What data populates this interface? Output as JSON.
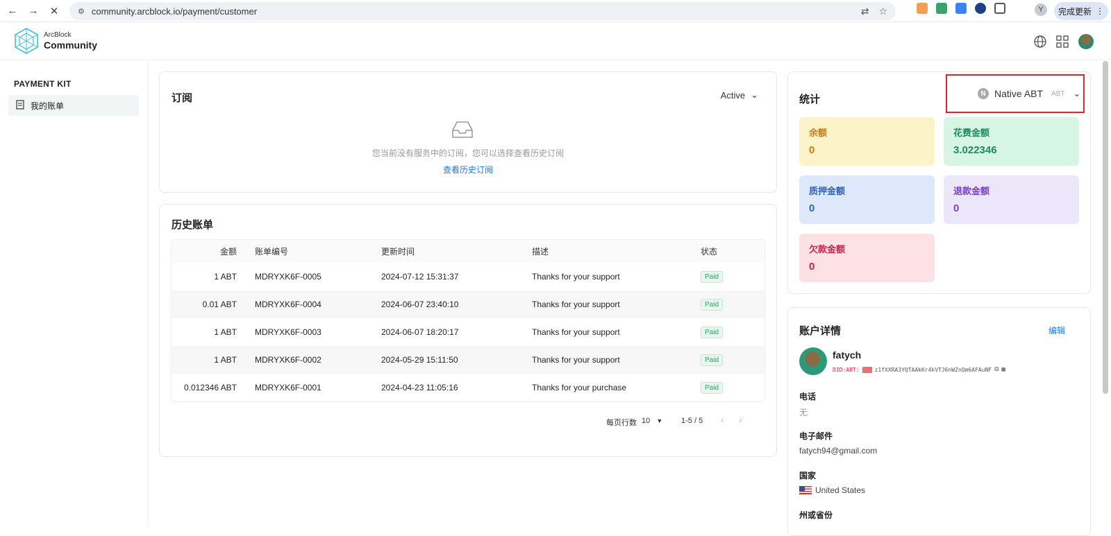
{
  "browser": {
    "url": "community.arcblock.io/payment/customer",
    "profile_initial": "Y",
    "update_label": "完成更新"
  },
  "header": {
    "brand_small": "ArcBlock",
    "brand_big": "Community"
  },
  "sidebar": {
    "section_title": "PAYMENT KIT",
    "items": [
      {
        "label": "我的账单",
        "icon": "receipt-icon"
      }
    ]
  },
  "subscriptions": {
    "title": "订阅",
    "filter_value": "Active",
    "empty_text": "您当前没有服务中的订阅，您可以选择查看历史订阅",
    "history_link": "查看历史订阅"
  },
  "invoices": {
    "title": "历史账单",
    "columns": [
      "金额",
      "账单编号",
      "更新时间",
      "描述",
      "状态"
    ],
    "rows": [
      {
        "amount": "1 ABT",
        "number": "MDRYXK6F-0005",
        "time": "2024-07-12 15:31:37",
        "desc": "Thanks for your support",
        "status": "Paid"
      },
      {
        "amount": "0.01 ABT",
        "number": "MDRYXK6F-0004",
        "time": "2024-06-07 23:40:10",
        "desc": "Thanks for your support",
        "status": "Paid"
      },
      {
        "amount": "1 ABT",
        "number": "MDRYXK6F-0003",
        "time": "2024-06-07 18:20:17",
        "desc": "Thanks for your support",
        "status": "Paid"
      },
      {
        "amount": "1 ABT",
        "number": "MDRYXK6F-0002",
        "time": "2024-05-29 15:11:50",
        "desc": "Thanks for your support",
        "status": "Paid"
      },
      {
        "amount": "0.012346 ABT",
        "number": "MDRYXK6F-0001",
        "time": "2024-04-23 11:05:16",
        "desc": "Thanks for your purchase",
        "status": "Paid"
      }
    ],
    "pagination": {
      "rows_per_page_label": "每页行数",
      "rows_per_page": "10",
      "range": "1-5 / 5"
    }
  },
  "stats": {
    "title": "统计",
    "currency": {
      "icon_letter": "N",
      "name": "Native ABT",
      "symbol": "ABT"
    },
    "items": [
      {
        "label": "余额",
        "value": "0",
        "bg": "#fdf3c8",
        "fg": "#c77d14"
      },
      {
        "label": "花费金额",
        "value": "3.022346",
        "bg": "#d6f5e3",
        "fg": "#1f8a5b"
      },
      {
        "label": "质押金额",
        "value": "0",
        "bg": "#dde9fb",
        "fg": "#2e62b8"
      },
      {
        "label": "退款金额",
        "value": "0",
        "bg": "#ece6fb",
        "fg": "#7a3fc9"
      },
      {
        "label": "欠款金额",
        "value": "0",
        "bg": "#fde1e4",
        "fg": "#c7254e"
      }
    ]
  },
  "account": {
    "title": "账户详情",
    "edit_label": "编辑",
    "name": "fatych",
    "did_prefix": "DID:ABT:",
    "did": "z1fXXRA3YQTAAkKr4kVTJ6nWZnQm6AFAuNF",
    "fields": [
      {
        "label": "电话",
        "value": "无"
      },
      {
        "label": "电子邮件",
        "value": "fatych94@gmail.com"
      },
      {
        "label": "国家",
        "value": "United States"
      },
      {
        "label": "州或省份",
        "value": ""
      }
    ]
  }
}
